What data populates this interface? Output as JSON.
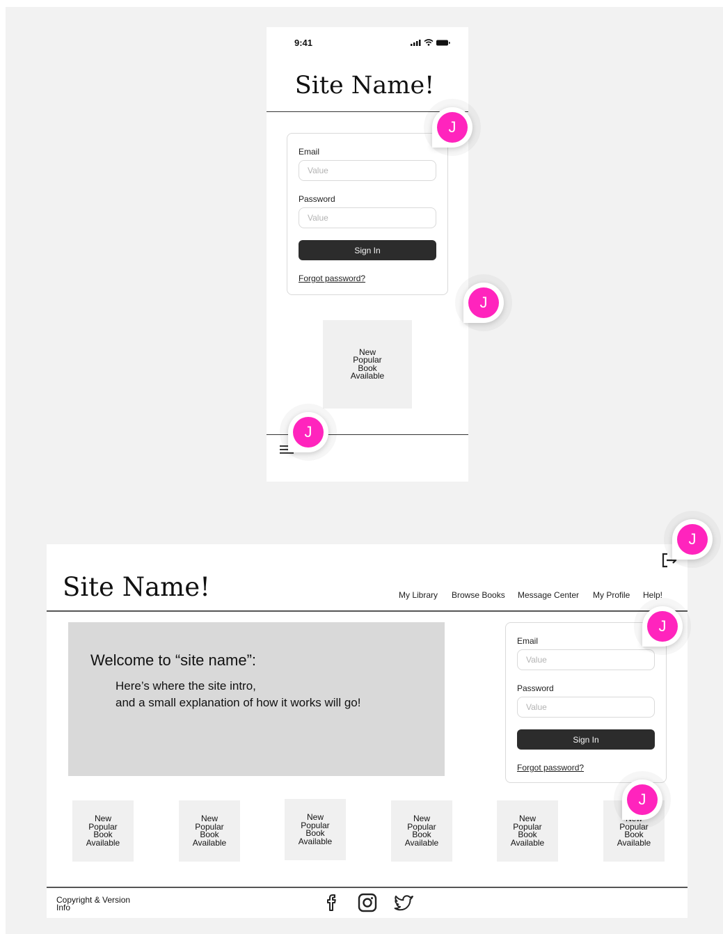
{
  "mobile": {
    "status_time": "9:41",
    "site_name": "Site Name!",
    "login": {
      "email_label": "Email",
      "email_placeholder": "Value",
      "password_label": "Password",
      "password_placeholder": "Value",
      "sign_in": "Sign In",
      "forgot": "Forgot password?"
    },
    "book": "New\nPopular\nBook\nAvailable"
  },
  "desktop": {
    "site_name": "Site Name!",
    "nav": [
      "My Library",
      "Browse Books",
      "Message Center",
      "My Profile",
      "Help!"
    ],
    "hero": {
      "title": "Welcome to “site name”:",
      "line1": "Here’s where the site intro,",
      "line2": "and a small explanation of how it works will go!"
    },
    "login": {
      "email_label": "Email",
      "email_placeholder": "Value",
      "password_label": "Password",
      "password_placeholder": "Value",
      "sign_in": "Sign In",
      "forgot": "Forgot password?"
    },
    "books": [
      "New\nPopular\nBook\nAvailable",
      "New\nPopular\nBook\nAvailable",
      "New\nPopular\nBook\nAvailable",
      "New\nPopular\nBook\nAvailable",
      "New\nPopular\nBook\nAvailable",
      "New\nPopular\nBook\nAvailable"
    ],
    "footer": "Copyright & Version\nInfo",
    "social_icons": [
      "facebook-icon",
      "instagram-icon",
      "twitter-icon"
    ]
  },
  "comment_avatar_initial": "J",
  "colors": {
    "avatar": "#ff24bd",
    "button": "#2c2c2c",
    "hero": "#d9d9d9",
    "canvas": "#f2f2f2"
  }
}
